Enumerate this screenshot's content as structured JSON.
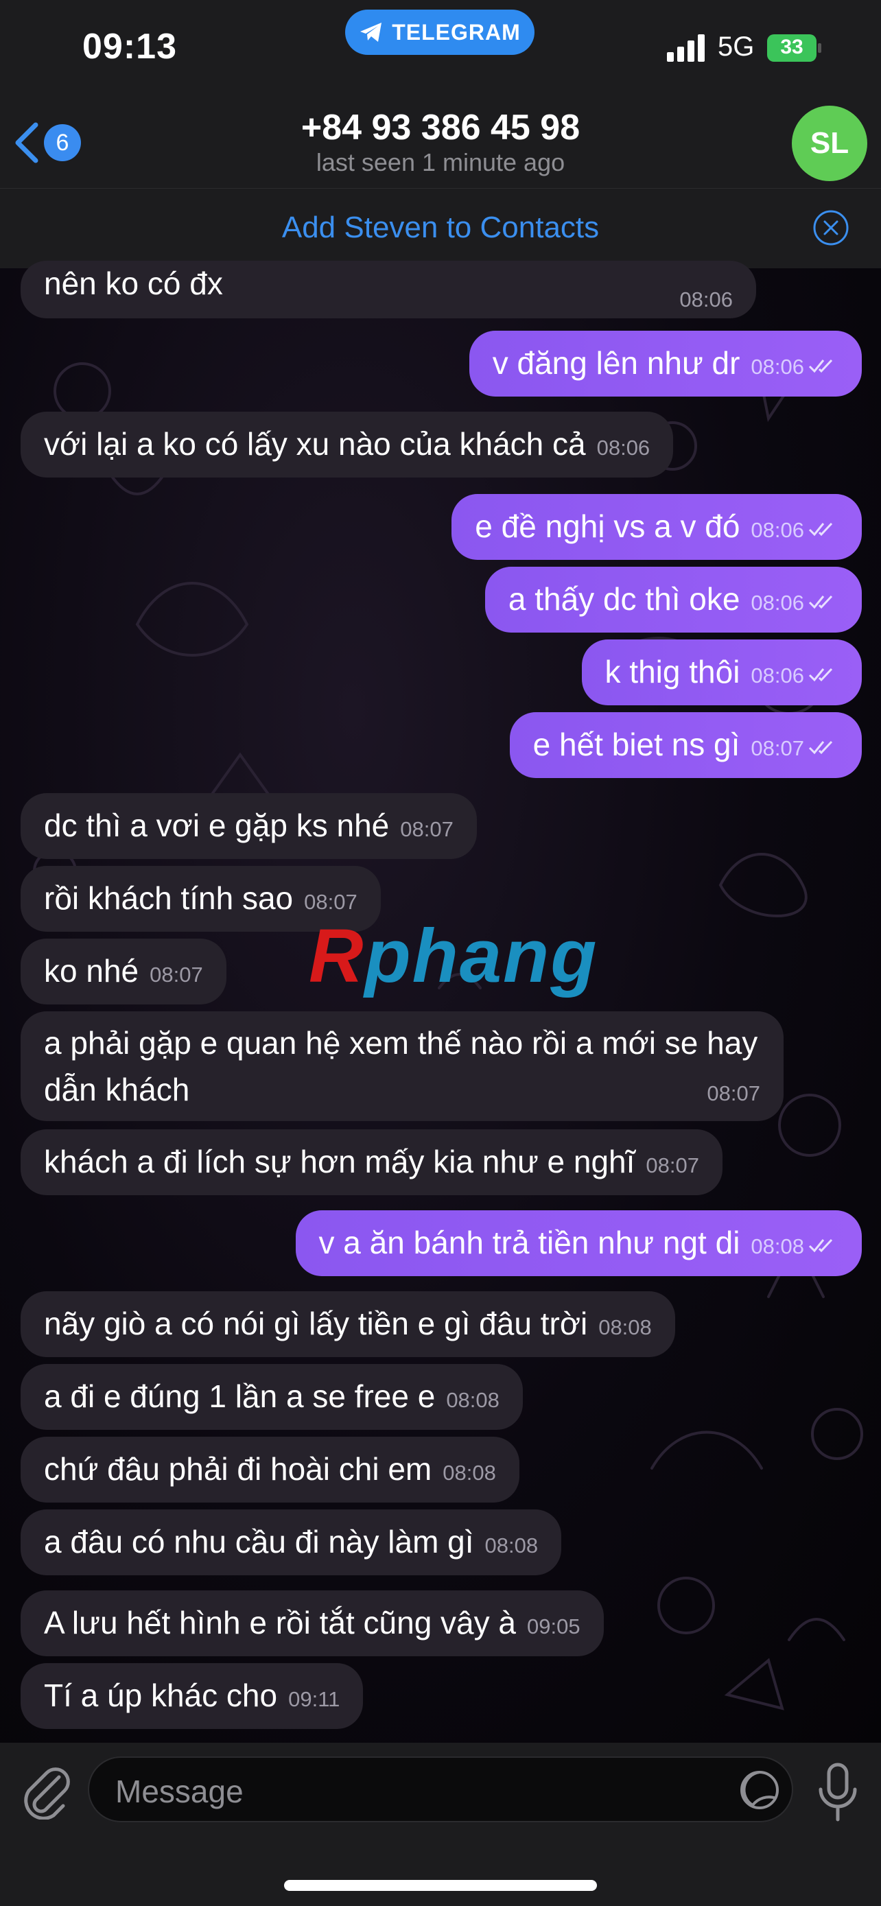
{
  "status_bar": {
    "time": "09:13",
    "pill_label": "TELEGRAM",
    "network": "5G",
    "battery": "33"
  },
  "header": {
    "back_badge": "6",
    "title": "+84 93 386 45 98",
    "subtitle": "last seen 1 minute ago",
    "avatar_initials": "SL",
    "avatar_color": "#5fcc55"
  },
  "banner": {
    "add_contact_label": "Add Steven to Contacts"
  },
  "messages": [
    {
      "dir": "in",
      "text": "nên ko có đx",
      "time": "08:06"
    },
    {
      "dir": "out",
      "text": "v đăng lên như dr",
      "time": "08:06"
    },
    {
      "dir": "in",
      "text": "với lại a ko có lấy xu nào của khách cả",
      "time": "08:06"
    },
    {
      "dir": "out",
      "text": "e đề nghị vs a v đó",
      "time": "08:06"
    },
    {
      "dir": "out",
      "text": "a thấy dc thì oke",
      "time": "08:06"
    },
    {
      "dir": "out",
      "text": "k thig thôi",
      "time": "08:06"
    },
    {
      "dir": "out",
      "text": "e hết biet ns gì",
      "time": "08:07"
    },
    {
      "dir": "in",
      "text": "dc thì a vơi e gặp ks nhé",
      "time": "08:07"
    },
    {
      "dir": "in",
      "text": "rồi khách tính sao",
      "time": "08:07"
    },
    {
      "dir": "in",
      "text": "ko nhé",
      "time": "08:07"
    },
    {
      "dir": "in",
      "text": "a phải gặp e quan hệ xem thế nào rồi a mới se hay dẫn khách",
      "time": "08:07"
    },
    {
      "dir": "in",
      "text": "khách a đi lích sự hơn mấy kia như e nghĩ",
      "time": "08:07"
    },
    {
      "dir": "out",
      "text": "v a ăn bánh trả tiền như ngt di",
      "time": "08:08"
    },
    {
      "dir": "in",
      "text": "nãy giò a có nói gì lấy tiền e gì đâu trời",
      "time": "08:08"
    },
    {
      "dir": "in",
      "text": "a đi e đúng 1 lần a se free e",
      "time": "08:08"
    },
    {
      "dir": "in",
      "text": "chứ đâu phải đi hoài chi em",
      "time": "08:08"
    },
    {
      "dir": "in",
      "text": "a đâu có nhu cầu đi này làm gì",
      "time": "08:08"
    },
    {
      "dir": "in",
      "text": "A lưu hết hình e rồi tắt cũng vây à",
      "time": "09:05"
    },
    {
      "dir": "in",
      "text": "Tí a úp khác cho",
      "time": "09:11"
    }
  ],
  "watermark": {
    "first": "R",
    "rest": "phang"
  },
  "input": {
    "placeholder": "Message"
  },
  "colors": {
    "incoming_bubble": "#26222b",
    "outgoing_bubble": "#8b57f0",
    "accent": "#3b8fef"
  },
  "icons": [
    "telegram-icon",
    "signal-icon",
    "back-chevron-icon",
    "close-circle-icon",
    "read-ticks-icon",
    "paperclip-icon",
    "sticker-icon",
    "mic-icon"
  ]
}
